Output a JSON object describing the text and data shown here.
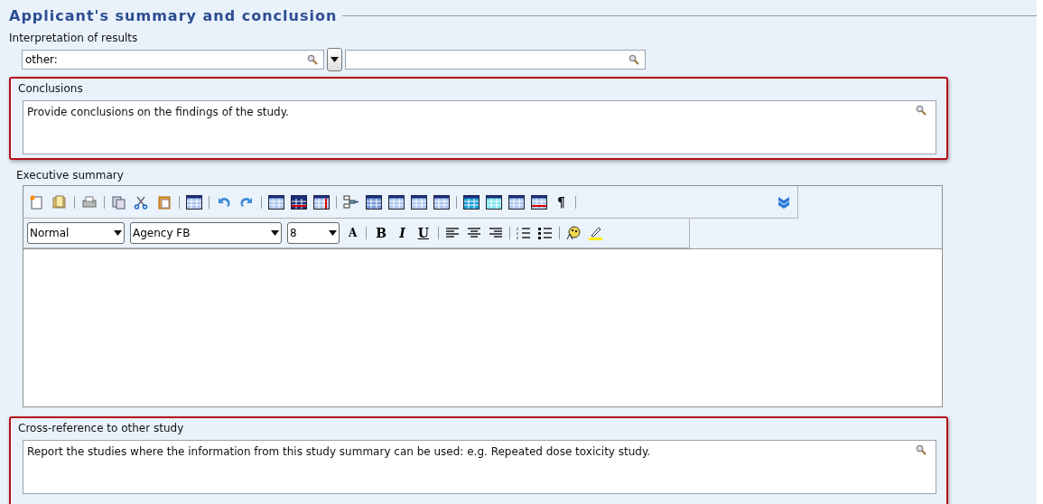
{
  "section": {
    "title": "Applicant's summary and conclusion"
  },
  "interpretation": {
    "label": "Interpretation of results",
    "value": "other:"
  },
  "conclusions": {
    "label": "Conclusions",
    "placeholder": "Provide conclusions on the findings of the study.",
    "highlighted": true
  },
  "executive_summary": {
    "label": "Executive summary",
    "toolbar_text": [
      "¶"
    ],
    "style": "Normal",
    "font": "Agency FB",
    "size": "8",
    "grow_label": "A",
    "format_buttons": [
      "B",
      "I",
      "U"
    ]
  },
  "cross_reference": {
    "label": "Cross-reference to other study",
    "placeholder": "Report the studies where the information from this study summary can be used: e.g. Repeated dose toxicity study.",
    "highlighted": true
  }
}
